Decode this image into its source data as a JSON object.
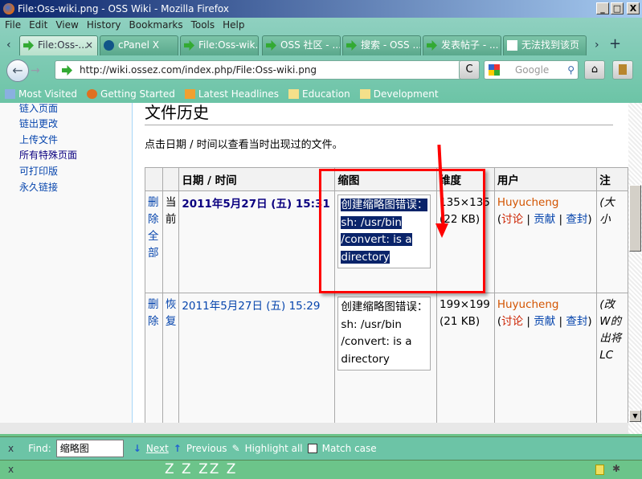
{
  "window": {
    "title": "File:Oss-wiki.png - OSS Wiki - Mozilla Firefox",
    "min": "_",
    "max": "□",
    "close": "X"
  },
  "menu": [
    "File",
    "Edit",
    "View",
    "History",
    "Bookmarks",
    "Tools",
    "Help"
  ],
  "tabs": [
    {
      "label": "File:Oss-..."
    },
    {
      "label": "cPanel X"
    },
    {
      "label": "File:Oss-wik..."
    },
    {
      "label": "OSS 社区 - ..."
    },
    {
      "label": "搜索 - OSS ..."
    },
    {
      "label": "发表帖子 - ..."
    },
    {
      "label": "无法找到该页"
    }
  ],
  "tab_controls": {
    "close": "×",
    "scroll_left": "‹",
    "scroll_right": "›",
    "new_tab": "+"
  },
  "nav": {
    "url": "http://wiki.ossez.com/index.php/File:Oss-wiki.png",
    "search_placeholder": "Google",
    "back": "←",
    "forward": "→",
    "reload": "C",
    "home": "⌂",
    "star": "☆"
  },
  "bookmarks": [
    "Most Visited",
    "Getting Started",
    "Latest Headlines",
    "Education",
    "Development"
  ],
  "sidebar": [
    "链入页面",
    "链出更改",
    "上传文件",
    "所有特殊页面",
    "可打印版",
    "永久链接"
  ],
  "page": {
    "heading": "文件历史",
    "intro": "点击日期 / 时间以查看当时出现过的文件。"
  },
  "table": {
    "headers": [
      "",
      "",
      "日期 / 时间",
      "缩图",
      "维度",
      "用户",
      "注"
    ],
    "rows": [
      {
        "action": "删除全部",
        "state": "当前",
        "date": "2011年5月27日 (五) 15:31",
        "thumb": "创建缩略图错误：sh: /usr/bin /convert: is a directory",
        "dims": "135×135",
        "size": "(22 KB)",
        "user": "Huyucheng",
        "talk": "讨论",
        "contribs": "贡献",
        "block": "查封",
        "comment": "(大小"
      },
      {
        "action": "删除",
        "state": "恢复",
        "date": "2011年5月27日 (五) 15:29",
        "thumb": "创建缩略图错误：sh: /usr/bin /convert: is a directory",
        "dims": "199×199",
        "size": "(21 KB)",
        "user": "Huyucheng",
        "talk": "讨论",
        "contribs": "贡献",
        "block": "查封",
        "comment": "(改W的出将LC"
      }
    ]
  },
  "findbar": {
    "close": "x",
    "label": "Find:",
    "value": "缩略图",
    "next": "Next",
    "previous": "Previous",
    "highlight": "Highlight all",
    "match_case": "Match case"
  },
  "statusbar": {
    "close": "x",
    "text": "Z Z ZZ Z"
  }
}
